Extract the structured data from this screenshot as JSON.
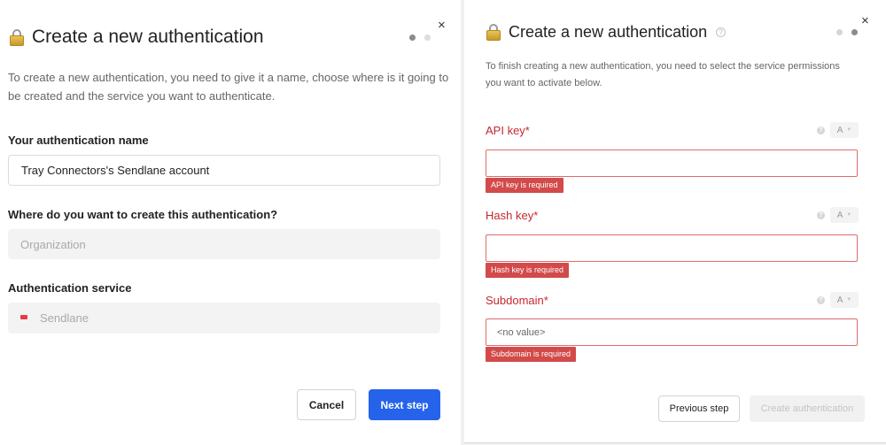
{
  "left_panel": {
    "title": "Create a new authentication",
    "description": "To create a new authentication, you need to give it a name, choose where is it going to be created and the service you want to authenticate.",
    "name_label": "Your authentication name",
    "name_value": "Tray Connectors's Sendlane account",
    "location_label": "Where do you want to create this authentication?",
    "location_placeholder": "Organization",
    "service_label": "Authentication service",
    "service_value": "Sendlane",
    "cancel_label": "Cancel",
    "next_label": "Next step",
    "close_symbol": "×"
  },
  "right_panel": {
    "title": "Create a new authentication",
    "help_symbol": "?",
    "description": "To finish creating a new authentication, you need to select the service permissions you want to activate below.",
    "fields": [
      {
        "label": "API key*",
        "value": "",
        "error": "API key is required",
        "type_value": "A"
      },
      {
        "label": "Hash key*",
        "value": "",
        "error": "Hash key is required",
        "type_value": "A"
      },
      {
        "label": "Subdomain*",
        "value": "<no value>",
        "error": "Subdomain is required",
        "type_value": "A"
      }
    ],
    "previous_label": "Previous step",
    "create_label": "Create authentication",
    "close_symbol": "×"
  },
  "colors": {
    "primary": "#2563eb",
    "error": "#c5282f",
    "error_badge": "#d24a4a",
    "step_active": "#3b9b5a",
    "step_inactive": "#dcdce2"
  }
}
